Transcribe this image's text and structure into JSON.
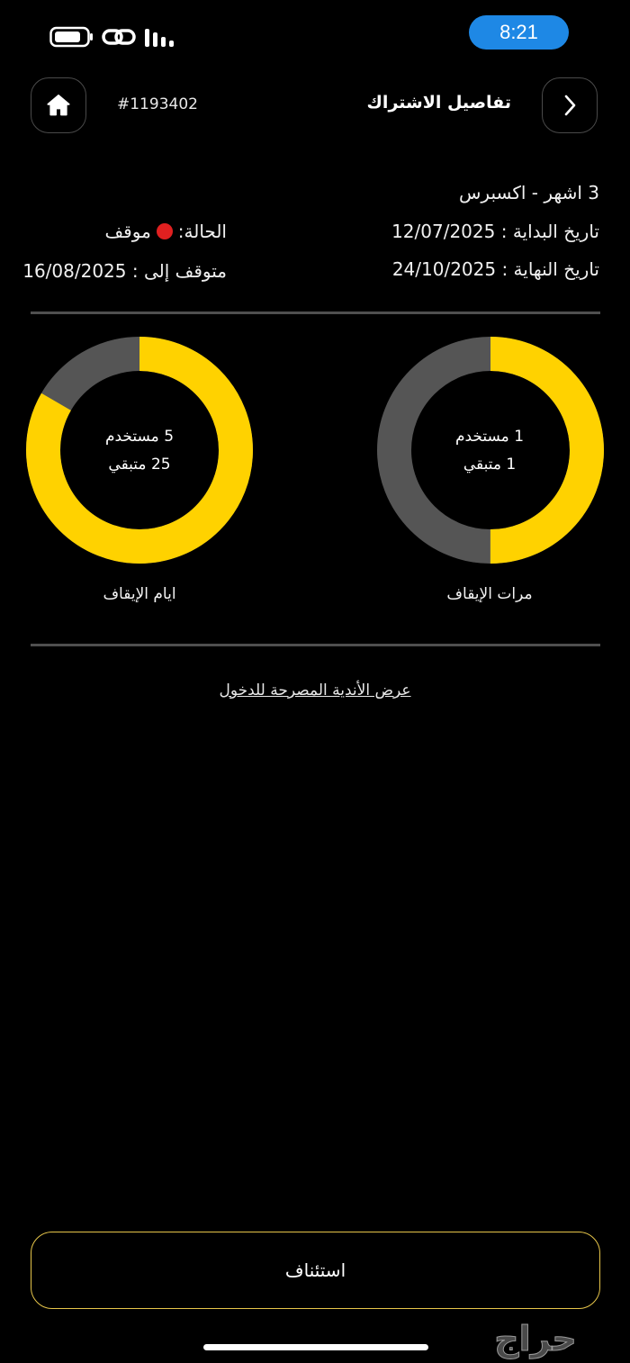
{
  "status_bar": {
    "time": "8:21"
  },
  "header": {
    "title": "تفاصيل الاشتراك",
    "subscription_id": "#1193402",
    "icons": {
      "home": "home-icon",
      "back": "chevron-right-icon"
    }
  },
  "details": {
    "plan": "3 اشهر - اكسبرس",
    "start_date": "تاريخ البداية : 12/07/2025",
    "end_date": "تاريخ النهاية : 24/10/2025",
    "status_label": "الحالة:",
    "status_value": "موقف",
    "paused_until": "متوقف إلى : 16/08/2025",
    "status_color": "#e02020"
  },
  "charts": [
    {
      "label": "مرات الإيقاف",
      "used_text": "1 مستخدم",
      "remaining_text": "1 متبقي",
      "used": 1,
      "remaining": 1
    },
    {
      "label": "ايام الإيقاف",
      "used_text": "5 مستخدم",
      "remaining_text": "25 متبقي",
      "used": 5,
      "remaining": 25
    }
  ],
  "colors": {
    "accent": "#ffd200",
    "track": "#555555",
    "button_border": "#e6c54a"
  },
  "clubs_link": "عرض الأندية المصرحة للدخول",
  "resume_button": "استئناف",
  "watermark": "حراج"
}
